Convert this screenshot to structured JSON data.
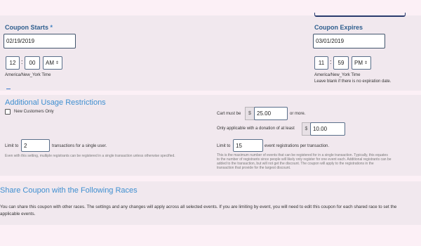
{
  "coupon_starts": {
    "label": "Coupon Starts",
    "required_mark": "*",
    "date": "02/19/2019",
    "hour": "12",
    "minute": "00",
    "ampm": "AM",
    "separator": ":",
    "timezone": "America/New_York Time"
  },
  "coupon_expires": {
    "label": "Coupon Expires",
    "date": "03/01/2019",
    "hour": "11",
    "minute": "59",
    "ampm": "PM",
    "separator": ":",
    "timezone": "America/New_York Time",
    "hint": "Leave blank if there is no expiration date."
  },
  "restrictions": {
    "title": "Additional Usage Restrictions",
    "new_customers_label": "New Customers Only",
    "cart_prefix": "Cart must be",
    "cart_currency": "$",
    "cart_value": "25.00",
    "cart_suffix": "or more.",
    "donation_label": "Only applicable with a donation of at least",
    "donation_currency": "$",
    "donation_value": "10.00",
    "limit_user_prefix": "Limit to",
    "limit_user_value": "2",
    "limit_user_suffix": "transactions for a single user.",
    "limit_user_help": "Even with this setting, multiple registrants can be registered in a single transaction unless otherwise specified.",
    "limit_event_prefix": "Limit to",
    "limit_event_value": "15",
    "limit_event_suffix": "event registrations per transaction.",
    "limit_event_help_1": "This is the maximum number of events that can be registered for in a single transaction. Typically, this equates",
    "limit_event_help_2": "to the number of registrants since people will likely only register for one event each. Additional registrants can be",
    "limit_event_help_3": "added to the transaction, but will not get the discount. The coupon will apply to the registrations in the",
    "limit_event_help_4": "transaction that provide for the largest discount."
  },
  "share": {
    "title": "Share Coupon with the Following Races",
    "text_1": "You can share this coupon with other races. The settings and any changes will apply across all selected events. If you are limiting by event, you will need to edit this coupon for each shared race to set the",
    "text_2": "applicable events."
  },
  "colors": {
    "accent": "#3f8fd0",
    "label": "#2e5e8e",
    "background": "#fcf0f6",
    "panel": "#f1e8ee"
  }
}
